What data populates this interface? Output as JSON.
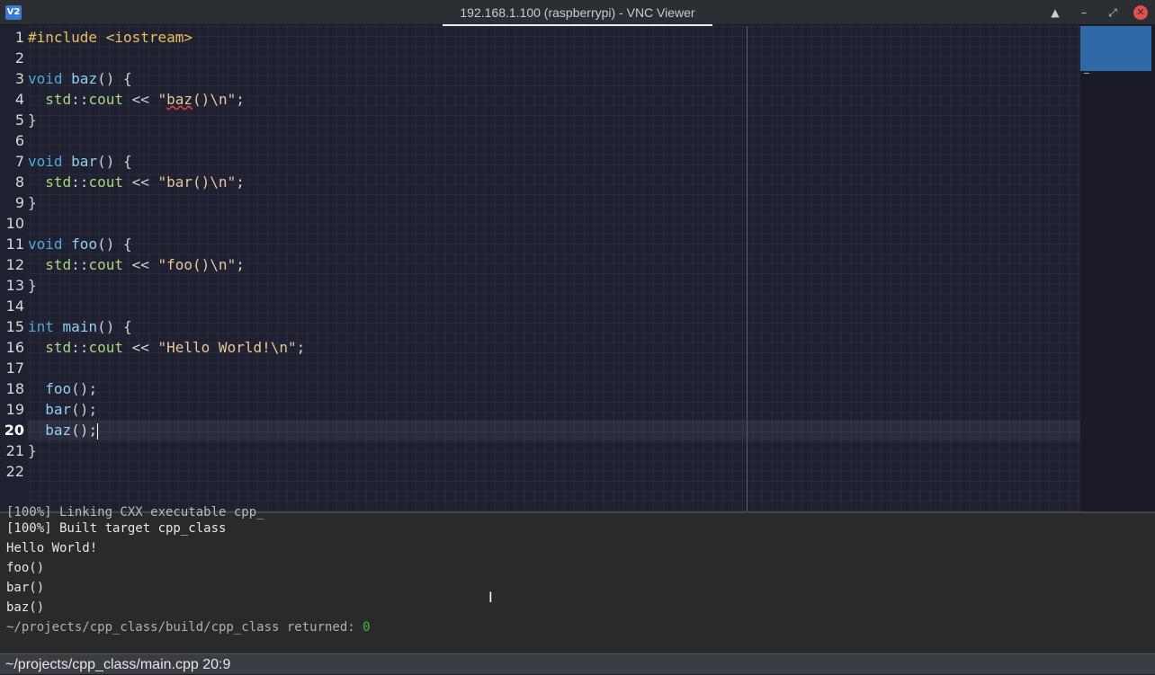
{
  "window": {
    "app_icon": "V2",
    "title": "192.168.1.100 (raspberrypi) - VNC Viewer",
    "buttons": {
      "shade": "▲",
      "minimize": "–",
      "maximize": "⤢",
      "close": "✕"
    }
  },
  "editor": {
    "current_line": 20,
    "lines": [
      {
        "n": "1",
        "tokens": [
          {
            "t": "#include ",
            "c": "pp"
          },
          {
            "t": "<iostream>",
            "c": "pp"
          }
        ]
      },
      {
        "n": "2",
        "tokens": []
      },
      {
        "n": "3",
        "tokens": [
          {
            "t": "void",
            "c": "kw"
          },
          {
            "t": " ",
            "c": ""
          },
          {
            "t": "baz",
            "c": "fn"
          },
          {
            "t": "() {",
            "c": "punct"
          }
        ]
      },
      {
        "n": "4",
        "tokens": [
          {
            "t": "  ",
            "c": ""
          },
          {
            "t": "std",
            "c": "ns"
          },
          {
            "t": "::",
            "c": "punct"
          },
          {
            "t": "cout",
            "c": "ns"
          },
          {
            "t": " << ",
            "c": "punct"
          },
          {
            "t": "\"",
            "c": "str"
          },
          {
            "t": "baz",
            "c": "str squiggle"
          },
          {
            "t": "()\\n\"",
            "c": "str"
          },
          {
            "t": ";",
            "c": "punct"
          }
        ]
      },
      {
        "n": "5",
        "tokens": [
          {
            "t": "}",
            "c": "punct"
          }
        ]
      },
      {
        "n": "6",
        "tokens": []
      },
      {
        "n": "7",
        "tokens": [
          {
            "t": "void",
            "c": "kw"
          },
          {
            "t": " ",
            "c": ""
          },
          {
            "t": "bar",
            "c": "fn"
          },
          {
            "t": "() {",
            "c": "punct"
          }
        ]
      },
      {
        "n": "8",
        "tokens": [
          {
            "t": "  ",
            "c": ""
          },
          {
            "t": "std",
            "c": "ns"
          },
          {
            "t": "::",
            "c": "punct"
          },
          {
            "t": "cout",
            "c": "ns"
          },
          {
            "t": " << ",
            "c": "punct"
          },
          {
            "t": "\"bar()\\n\"",
            "c": "str"
          },
          {
            "t": ";",
            "c": "punct"
          }
        ]
      },
      {
        "n": "9",
        "tokens": [
          {
            "t": "}",
            "c": "punct"
          }
        ]
      },
      {
        "n": "10",
        "tokens": []
      },
      {
        "n": "11",
        "tokens": [
          {
            "t": "void",
            "c": "kw"
          },
          {
            "t": " ",
            "c": ""
          },
          {
            "t": "foo",
            "c": "fn"
          },
          {
            "t": "() {",
            "c": "punct"
          }
        ]
      },
      {
        "n": "12",
        "tokens": [
          {
            "t": "  ",
            "c": ""
          },
          {
            "t": "std",
            "c": "ns"
          },
          {
            "t": "::",
            "c": "punct"
          },
          {
            "t": "cout",
            "c": "ns"
          },
          {
            "t": " << ",
            "c": "punct"
          },
          {
            "t": "\"foo()\\n\"",
            "c": "str"
          },
          {
            "t": ";",
            "c": "punct"
          }
        ]
      },
      {
        "n": "13",
        "tokens": [
          {
            "t": "}",
            "c": "punct"
          }
        ]
      },
      {
        "n": "14",
        "tokens": []
      },
      {
        "n": "15",
        "tokens": [
          {
            "t": "int",
            "c": "kw"
          },
          {
            "t": " ",
            "c": ""
          },
          {
            "t": "main",
            "c": "fn"
          },
          {
            "t": "() {",
            "c": "punct"
          }
        ]
      },
      {
        "n": "16",
        "tokens": [
          {
            "t": "  ",
            "c": ""
          },
          {
            "t": "std",
            "c": "ns"
          },
          {
            "t": "::",
            "c": "punct"
          },
          {
            "t": "cout",
            "c": "ns"
          },
          {
            "t": " << ",
            "c": "punct"
          },
          {
            "t": "\"Hello World!\\n\"",
            "c": "str"
          },
          {
            "t": ";",
            "c": "punct"
          }
        ]
      },
      {
        "n": "17",
        "tokens": []
      },
      {
        "n": "18",
        "tokens": [
          {
            "t": "  ",
            "c": ""
          },
          {
            "t": "foo",
            "c": "fn"
          },
          {
            "t": "();",
            "c": "punct"
          }
        ]
      },
      {
        "n": "19",
        "tokens": [
          {
            "t": "  ",
            "c": ""
          },
          {
            "t": "bar",
            "c": "fn"
          },
          {
            "t": "();",
            "c": "punct"
          }
        ]
      },
      {
        "n": "20",
        "tokens": [
          {
            "t": "  ",
            "c": ""
          },
          {
            "t": "baz",
            "c": "fn"
          },
          {
            "t": "();",
            "c": "punct"
          }
        ],
        "cursor": true
      },
      {
        "n": "21",
        "tokens": [
          {
            "t": "}",
            "c": "punct"
          }
        ]
      },
      {
        "n": "22",
        "tokens": []
      }
    ]
  },
  "output": {
    "lines": [
      "[100%] Built target cpp_class",
      "Hello World!",
      "foo()",
      "bar()",
      "baz()"
    ],
    "return_prefix": "~/projects/cpp_class/build/cpp_class returned: ",
    "return_value": "0"
  },
  "statusbar": {
    "text": "~/projects/cpp_class/main.cpp 20:9"
  },
  "icons": {
    "app": "vnc-icon",
    "mouse_cursor": "text-ibeam-icon"
  }
}
